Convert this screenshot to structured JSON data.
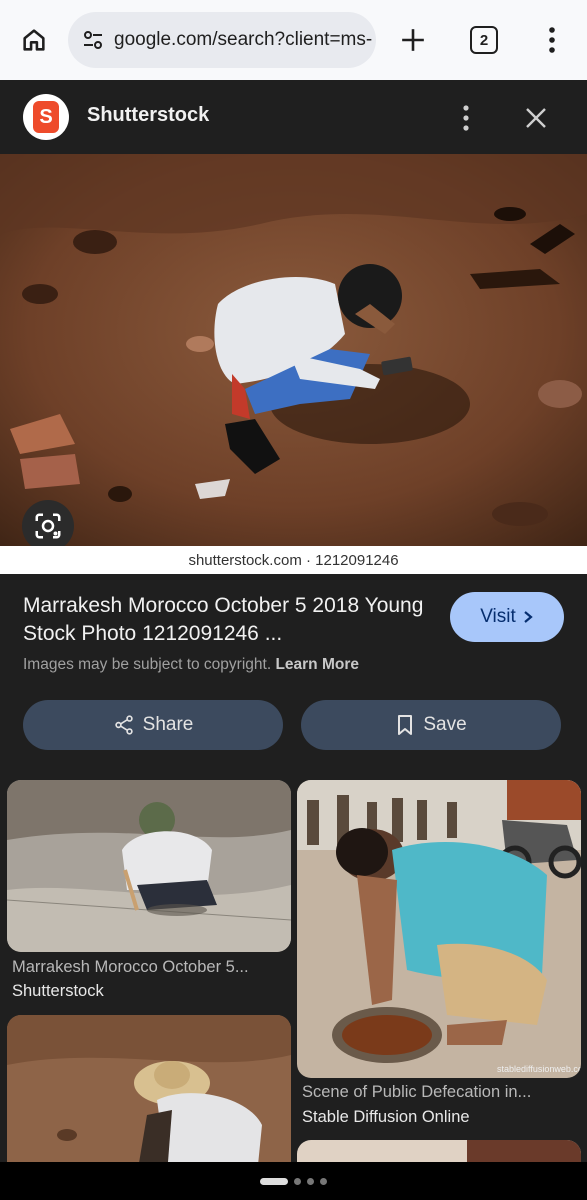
{
  "browser": {
    "url": "google.com/search?client=ms-",
    "tab_count": "2"
  },
  "panel": {
    "source_name": "Shutterstock",
    "watermark": "shutterstock.com · 1212091246",
    "title": "Marrakesh Morocco October 5 2018 Young Stock Photo 1212091246 ...",
    "visit_label": "Visit",
    "copyright_text": "Images may be subject to copyright.",
    "learn_more": "Learn More",
    "share_label": "Share",
    "save_label": "Save"
  },
  "results": [
    {
      "title": "Marrakesh Morocco October 5...",
      "source": "Shutterstock"
    },
    {
      "title": "Scene of Public Defecation in...",
      "source": "Stable Diffusion Online",
      "image_watermark": "stablediffusionweb.co"
    }
  ],
  "pager": {
    "count": 4,
    "active": 0
  }
}
